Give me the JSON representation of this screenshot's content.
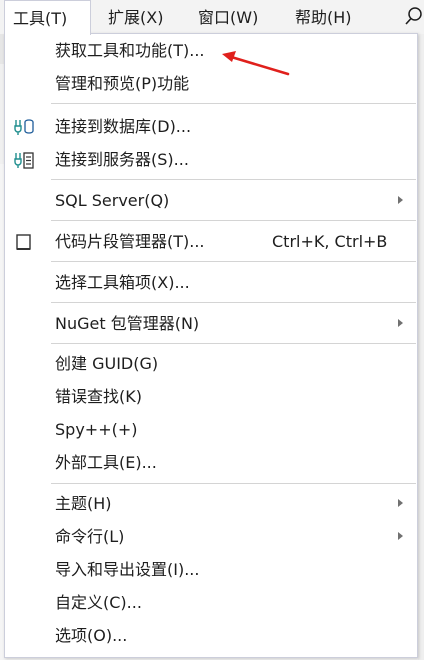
{
  "menubar": {
    "items": [
      {
        "label": "工具(T)"
      },
      {
        "label": "扩展(X)"
      },
      {
        "label": "窗口(W)"
      },
      {
        "label": "帮助(H)"
      }
    ],
    "search_icon": "search-icon"
  },
  "menu": {
    "items": [
      {
        "label": "获取工具和功能(T)..."
      },
      {
        "label": "管理和预览(P)功能"
      },
      {
        "label": "连接到数据库(D)...",
        "icon": "database-connect-icon"
      },
      {
        "label": "连接到服务器(S)...",
        "icon": "server-connect-icon"
      },
      {
        "label": "SQL Server(Q)",
        "submenu": true
      },
      {
        "label": "代码片段管理器(T)...",
        "shortcut": "Ctrl+K, Ctrl+B",
        "icon": "snippet-manager-icon"
      },
      {
        "label": "选择工具箱项(X)..."
      },
      {
        "label": "NuGet 包管理器(N)",
        "submenu": true
      },
      {
        "label": "创建 GUID(G)"
      },
      {
        "label": "错误查找(K)"
      },
      {
        "label": "Spy++(+)"
      },
      {
        "label": "外部工具(E)..."
      },
      {
        "label": "主题(H)",
        "submenu": true
      },
      {
        "label": "命令行(L)",
        "submenu": true
      },
      {
        "label": "导入和导出设置(I)..."
      },
      {
        "label": "自定义(C)..."
      },
      {
        "label": "选项(O)..."
      }
    ]
  },
  "colors": {
    "annotation_arrow": "#e0201c",
    "menu_border": "#cccedb",
    "icon_accent": "#1f8e8e"
  }
}
